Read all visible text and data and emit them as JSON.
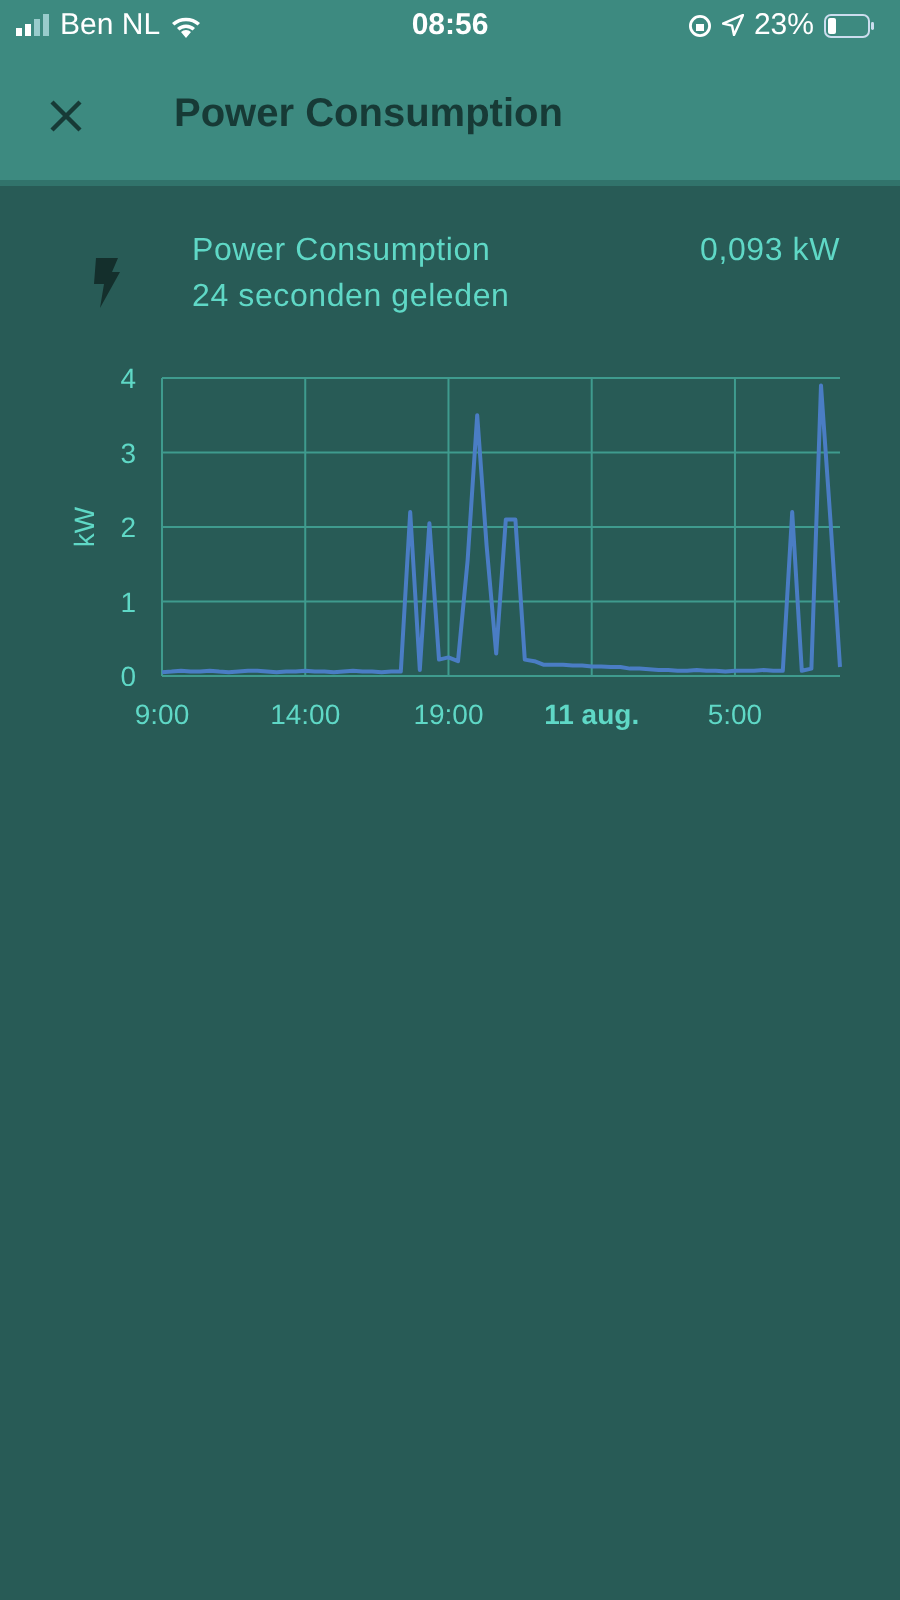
{
  "status_bar": {
    "carrier": "Ben NL",
    "time": "08:56",
    "battery": "23%"
  },
  "header": {
    "title": "Power Consumption"
  },
  "entity": {
    "name": "Power Consumption",
    "updated": "24 seconden geleden",
    "value": "0,093 kW"
  },
  "chart": {
    "chart_data": {
      "type": "line",
      "grid": true,
      "ylabel": "kW",
      "ylim": [
        0,
        4
      ],
      "yticks": [
        0,
        1,
        2,
        3,
        4
      ],
      "categories": [
        "9:00",
        null,
        null,
        null,
        null,
        null,
        null,
        null,
        null,
        null,
        null,
        null,
        null,
        null,
        null,
        "14:00",
        null,
        null,
        null,
        null,
        null,
        null,
        null,
        null,
        null,
        null,
        null,
        null,
        null,
        null,
        "19:00",
        null,
        null,
        null,
        null,
        null,
        null,
        null,
        null,
        null,
        null,
        null,
        null,
        null,
        null,
        "**11 aug.**",
        null,
        null,
        null,
        null,
        null,
        null,
        null,
        null,
        null,
        null,
        null,
        null,
        null,
        null,
        "5:00",
        null,
        null,
        null,
        null,
        null,
        null,
        null,
        null,
        null,
        null,
        null
      ],
      "series": [
        {
          "color": "#4a7dc4",
          "values": [
            0.05,
            0.06,
            0.07,
            0.06,
            0.06,
            0.07,
            0.06,
            0.05,
            0.06,
            0.07,
            0.07,
            0.06,
            0.05,
            0.06,
            0.06,
            0.07,
            0.06,
            0.06,
            0.05,
            0.06,
            0.07,
            0.06,
            0.06,
            0.05,
            0.06,
            0.06,
            2.2,
            0.08,
            2.05,
            0.22,
            0.25,
            0.2,
            1.55,
            3.5,
            1.75,
            0.3,
            2.1,
            2.1,
            0.22,
            0.2,
            0.15,
            0.15,
            0.15,
            0.14,
            0.14,
            0.13,
            0.13,
            0.12,
            0.12,
            0.1,
            0.1,
            0.09,
            0.08,
            0.08,
            0.07,
            0.07,
            0.08,
            0.07,
            0.07,
            0.06,
            0.07,
            0.07,
            0.07,
            0.08,
            0.07,
            0.07,
            2.2,
            0.07,
            0.1,
            3.9,
            2.1,
            0.12
          ]
        }
      ]
    }
  }
}
